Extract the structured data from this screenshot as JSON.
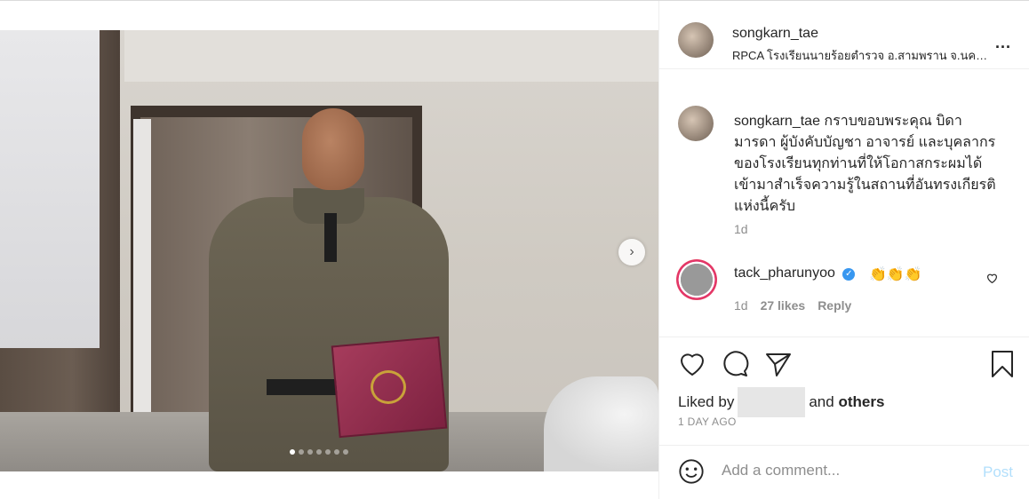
{
  "header": {
    "username": "songkarn_tae",
    "location": "RPCA โรงเรียนนายร้อยตำรวจ อ.สามพราน จ.นครปฐม",
    "more_icon": "more-icon",
    "more_label": "..."
  },
  "carousel": {
    "next_glyph": "›",
    "slide_count": 7,
    "active_index": 0
  },
  "caption": {
    "username": "songkarn_tae",
    "text": "กราบขอบพระคุณ บิดา มารดา ผู้บังคับบัญชา อาจารย์ และบุคลากรของโรงเรียนทุกท่านที่ให้โอกาสกระผมได้เข้ามาสำเร็จความรู้ในสถานที่อันทรงเกียรติแห่งนี้ครับ",
    "time": "1d"
  },
  "comments": [
    {
      "username": "tack_pharunyoo",
      "verified_glyph": "✓",
      "text": "👏👏👏",
      "time": "1d",
      "likes": "27 likes",
      "reply": "Reply"
    }
  ],
  "actions": {
    "liked_prefix": "Liked by",
    "liked_suffix": "and",
    "others": "others",
    "posted_ago": "1 DAY AGO"
  },
  "comment_box": {
    "placeholder": "Add a comment...",
    "post_label": "Post"
  },
  "colors": {
    "accent": "#3897f0",
    "post_disabled": "#b2dffc",
    "secondary_text": "#8e8e8e"
  }
}
